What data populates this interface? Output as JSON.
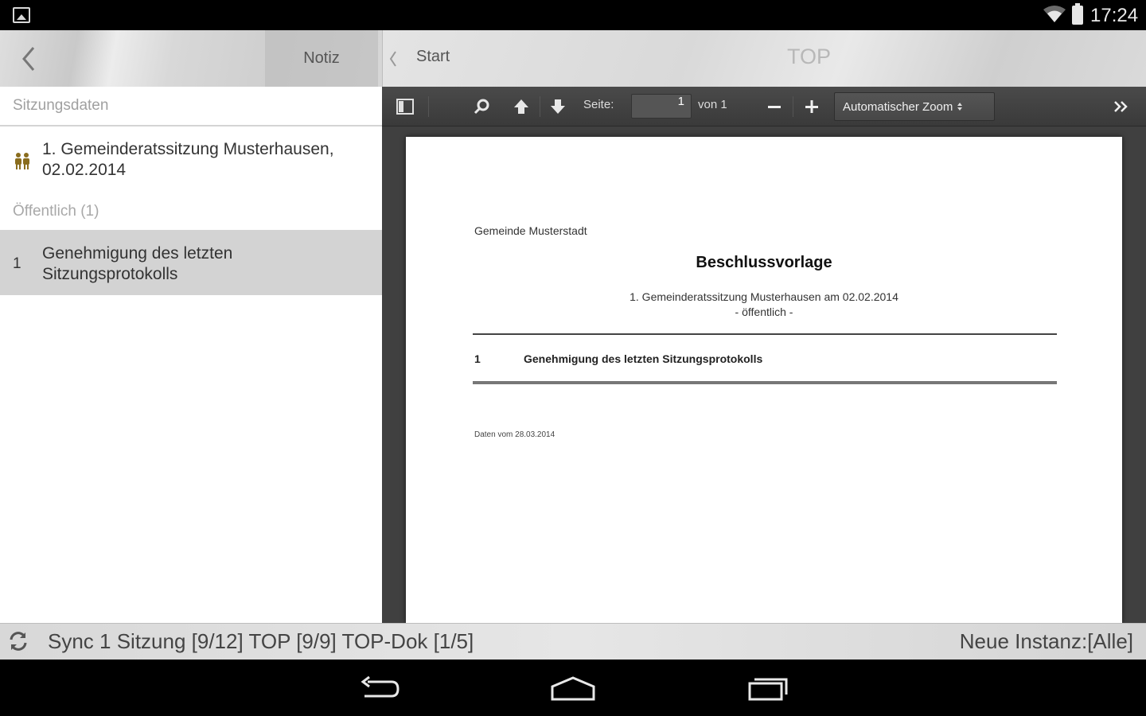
{
  "status_bar": {
    "time": "17:24"
  },
  "left_actionbar": {
    "notiz_label": "Notiz"
  },
  "left_panel": {
    "section_header": "Sitzungsdaten",
    "session_title_line1": "1. Gemeinderatssitzung Musterhausen,",
    "session_title_line2": "02.02.2014",
    "subheader": "Öffentlich (1)",
    "top_item": {
      "number": "1",
      "line1": "Genehmigung des letzten",
      "line2": "Sitzungsprotokolls"
    }
  },
  "right_actionbar": {
    "start_label": "Start",
    "title": "TOP"
  },
  "pdf_toolbar": {
    "page_label": "Seite:",
    "page_value": "1",
    "page_of": "von 1",
    "zoom_label": "Automatischer Zoom"
  },
  "pdf_document": {
    "municipality": "Gemeinde Musterstadt",
    "title": "Beschlussvorlage",
    "subtitle_line1": "1. Gemeinderatssitzung Musterhausen am 02.02.2014",
    "subtitle_line2": "- öffentlich -",
    "item_number": "1",
    "item_title": "Genehmigung des letzten Sitzungsprotokolls",
    "date_note": "Daten vom 28.03.2014"
  },
  "sync_bar": {
    "sync_text": "Sync 1 Sitzung [9/12] TOP [9/9] TOP-Dok [1/5]",
    "instance_text": "Neue Instanz:[Alle]"
  },
  "colors": {
    "accent_icon": "#8a6d1e",
    "selected_row": "#d3d3d3",
    "viewer_bg": "#404040"
  }
}
